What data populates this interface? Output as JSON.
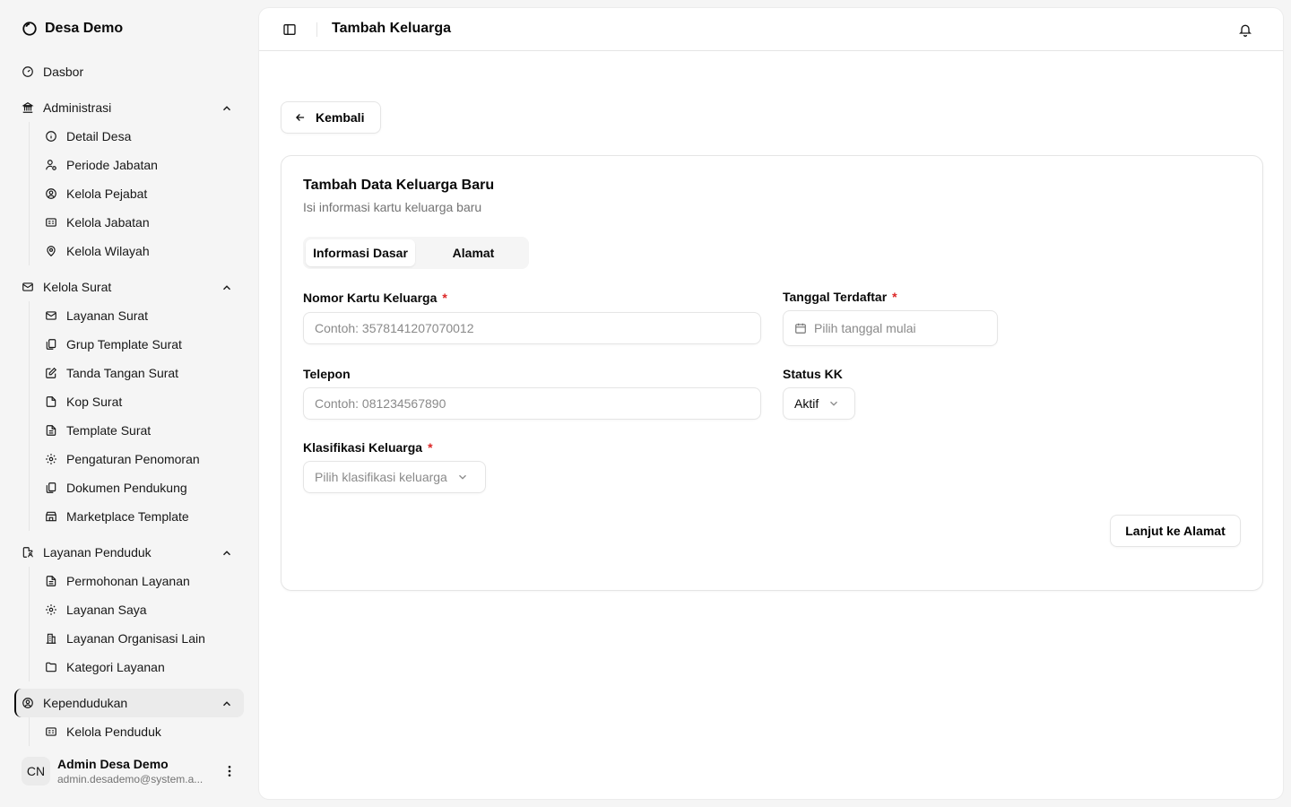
{
  "app": {
    "name": "Desa Demo"
  },
  "sidebar": {
    "dashboard": "Dasbor",
    "groups": [
      {
        "label": "Administrasi",
        "items": [
          "Detail Desa",
          "Periode Jabatan",
          "Kelola Pejabat",
          "Kelola Jabatan",
          "Kelola Wilayah"
        ]
      },
      {
        "label": "Kelola Surat",
        "items": [
          "Layanan Surat",
          "Grup Template Surat",
          "Tanda Tangan Surat",
          "Kop Surat",
          "Template Surat",
          "Pengaturan Penomoran",
          "Dokumen Pendukung",
          "Marketplace Template"
        ]
      },
      {
        "label": "Layanan Penduduk",
        "items": [
          "Permohonan Layanan",
          "Layanan Saya",
          "Layanan Organisasi Lain",
          "Kategori Layanan"
        ]
      },
      {
        "label": "Kependudukan",
        "items": [
          "Kelola Penduduk"
        ]
      }
    ]
  },
  "user": {
    "initials": "CN",
    "name": "Admin Desa Demo",
    "email": "admin.desademo@system.a..."
  },
  "header": {
    "title": "Tambah Keluarga"
  },
  "back_label": "Kembali",
  "form": {
    "title": "Tambah Data Keluarga Baru",
    "subtitle": "Isi informasi kartu keluarga baru",
    "tabs": [
      "Informasi Dasar",
      "Alamat"
    ],
    "required_mark": "*",
    "nkk": {
      "label": "Nomor Kartu Keluarga",
      "placeholder": "Contoh: 3578141207070012"
    },
    "tanggal": {
      "label": "Tanggal Terdaftar",
      "placeholder": "Pilih tanggal mulai"
    },
    "telepon": {
      "label": "Telepon",
      "placeholder": "Contoh: 081234567890"
    },
    "status": {
      "label": "Status KK",
      "value": "Aktif"
    },
    "klasifikasi": {
      "label": "Klasifikasi Keluarga",
      "placeholder": "Pilih klasifikasi keluarga"
    },
    "next_label": "Lanjut ke Alamat"
  }
}
